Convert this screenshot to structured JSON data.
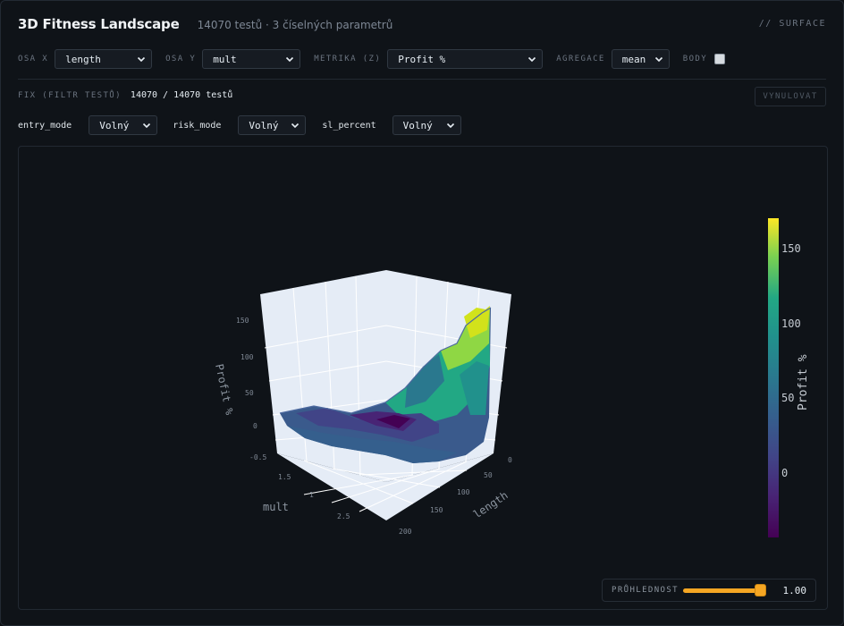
{
  "header": {
    "title": "3D Fitness Landscape",
    "subtitle": "14070 testů · 3 číselných parametrů",
    "tag": "// SURFACE"
  },
  "controls": {
    "axis_x": {
      "label": "OSA X",
      "value": "length"
    },
    "axis_y": {
      "label": "OSA Y",
      "value": "mult"
    },
    "metric": {
      "label": "METRIKA (Z)",
      "value": "Profit %"
    },
    "aggregation": {
      "label": "AGREGACE",
      "value": "mean"
    },
    "points": {
      "label": "BODY",
      "checked": false
    }
  },
  "filter": {
    "label": "FIX (FILTR TESTŮ)",
    "value": "14070 / 14070 testů",
    "reset_label": "VYNULOVAT",
    "params": [
      {
        "name": "entry_mode",
        "value": "Volný"
      },
      {
        "name": "risk_mode",
        "value": "Volný"
      },
      {
        "name": "sl_percent",
        "value": "Volný"
      }
    ]
  },
  "opacity": {
    "label": "PRŮHLEDNOST",
    "value": "1.00",
    "level": 1.0
  },
  "chart_data": {
    "type": "surface",
    "xlabel": "length",
    "ylabel": "mult",
    "zlabel": "Profit %",
    "x_ticks": [
      "0",
      "50",
      "100",
      "150",
      "200"
    ],
    "y_ticks": [
      "-0.5",
      "1.5",
      "1",
      "2.5"
    ],
    "z_ticks": [
      "0",
      "50",
      "100",
      "150"
    ],
    "colorbar": {
      "title": "Profit %",
      "ticks": [
        "0",
        "50",
        "100",
        "150"
      ],
      "range": [
        -45,
        170
      ],
      "colorscale": "viridis"
    }
  }
}
